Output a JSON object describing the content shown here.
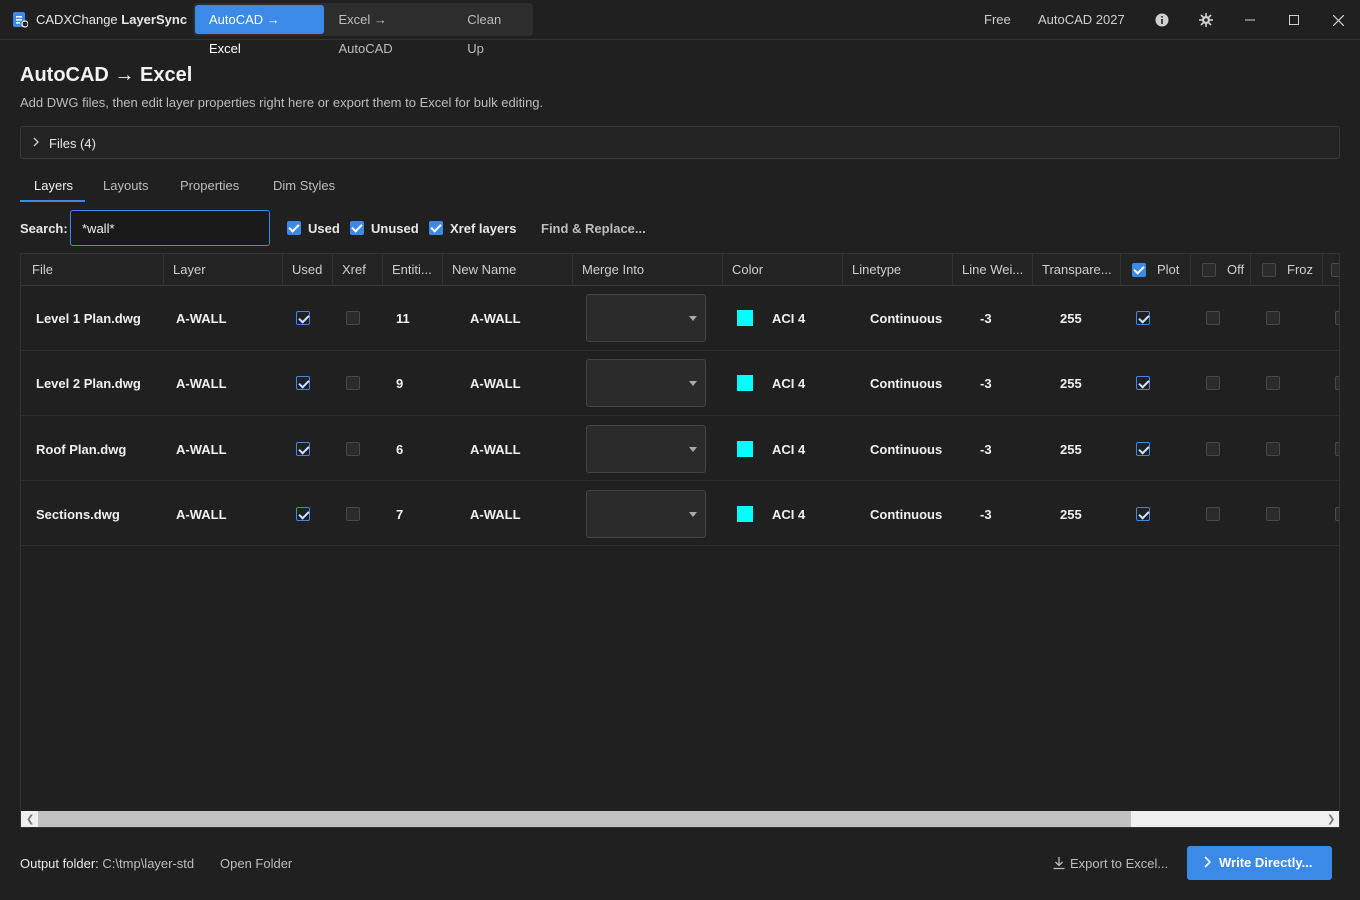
{
  "app": {
    "name_plain": "CADXChange ",
    "name_bold": "LayerSync"
  },
  "nav": {
    "tabs": [
      {
        "label": "AutoCAD → Excel"
      },
      {
        "label": "Excel → AutoCAD"
      },
      {
        "label": "Clean Up"
      }
    ]
  },
  "titlebar": {
    "plan": "Free",
    "version": "AutoCAD 2027"
  },
  "header": {
    "title": "AutoCAD → Excel",
    "subtitle": "Add DWG files, then edit layer properties right here or export them to Excel for bulk editing."
  },
  "files": {
    "label": "Files (4)"
  },
  "subtabs": [
    {
      "label": "Layers"
    },
    {
      "label": "Layouts"
    },
    {
      "label": "Properties"
    },
    {
      "label": "Dim Styles"
    }
  ],
  "search": {
    "label": "Search:",
    "value": "*wall*"
  },
  "filters": [
    {
      "label": "Used",
      "checked": true
    },
    {
      "label": "Unused",
      "checked": true
    },
    {
      "label": "Xref layers",
      "checked": true
    }
  ],
  "find_replace": "Find & Replace...",
  "columns": {
    "file": "File",
    "layer": "Layer",
    "used": "Used",
    "xref": "Xref",
    "entities": "Entiti...",
    "new_name": "New Name",
    "merge_into": "Merge Into",
    "color": "Color",
    "linetype": "Linetype",
    "line_weight": "Line Wei...",
    "transparency": "Transpare...",
    "plot": "Plot",
    "off": "Off",
    "frozen": "Froz"
  },
  "rows": [
    {
      "file": "Level 1 Plan.dwg",
      "layer": "A-WALL",
      "used": true,
      "xref": false,
      "entities": "11",
      "new_name": "A-WALL",
      "color": "ACI 4",
      "linetype": "Continuous",
      "line_weight": "-3",
      "transparency": "255",
      "plot": true,
      "off": false,
      "frozen": false
    },
    {
      "file": "Level 2 Plan.dwg",
      "layer": "A-WALL",
      "used": true,
      "xref": false,
      "entities": "9",
      "new_name": "A-WALL",
      "color": "ACI 4",
      "linetype": "Continuous",
      "line_weight": "-3",
      "transparency": "255",
      "plot": true,
      "off": false,
      "frozen": false
    },
    {
      "file": "Roof Plan.dwg",
      "layer": "A-WALL",
      "used": true,
      "xref": false,
      "entities": "6",
      "new_name": "A-WALL",
      "color": "ACI 4",
      "linetype": "Continuous",
      "line_weight": "-3",
      "transparency": "255",
      "plot": true,
      "off": false,
      "frozen": false
    },
    {
      "file": "Sections.dwg",
      "layer": "A-WALL",
      "used": true,
      "xref": false,
      "entities": "7",
      "new_name": "A-WALL",
      "color": "ACI 4",
      "linetype": "Continuous",
      "line_weight": "-3",
      "transparency": "255",
      "plot": true,
      "off": false,
      "frozen": false
    }
  ],
  "colors": {
    "accent": "#3b8ae8",
    "aci4": "#00ffff",
    "background": "#202020"
  },
  "footer": {
    "output_label": "Output folder:",
    "output_path": "C:\\tmp\\layer-std",
    "open_folder": "Open Folder",
    "export": "Export to Excel...",
    "write": "Write Directly..."
  }
}
